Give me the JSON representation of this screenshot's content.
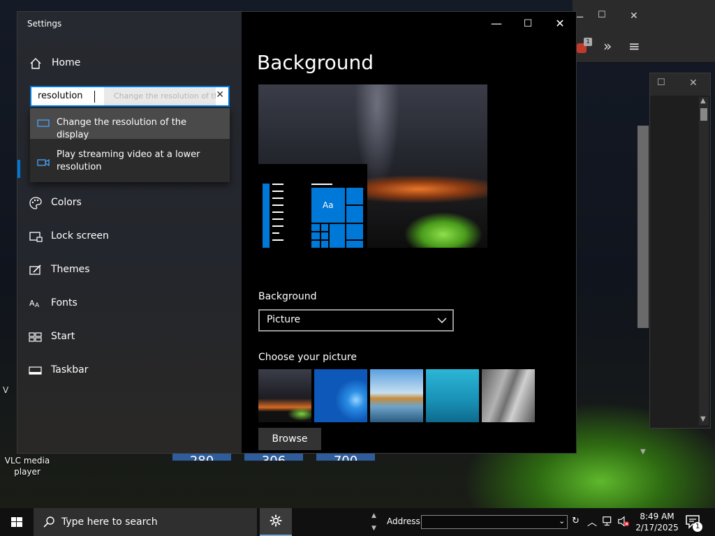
{
  "desktop": {
    "vlc_label": "VLC media player",
    "partial_char": "V",
    "background_numbers": [
      "280",
      "306",
      "700"
    ]
  },
  "bg_browser": {
    "minimize": "—",
    "maximize": "☐",
    "close": "✕",
    "badge_count": "1",
    "overflow": "»",
    "menu": "≡"
  },
  "settings": {
    "app_title": "Settings",
    "home_label": "Home",
    "search": {
      "value": "resolution",
      "suggestion_ghost": "Change the resolution of the display",
      "clear": "✕"
    },
    "suggestions": [
      {
        "label": "Change the resolution of the display",
        "icon": "monitor-icon"
      },
      {
        "label": "Play streaming video at a lower resolution",
        "icon": "video-icon"
      }
    ],
    "nav": [
      {
        "label": "Colors",
        "icon": "palette-icon"
      },
      {
        "label": "Lock screen",
        "icon": "lock-screen-icon"
      },
      {
        "label": "Themes",
        "icon": "themes-icon"
      },
      {
        "label": "Fonts",
        "icon": "fonts-icon"
      },
      {
        "label": "Start",
        "icon": "start-icon"
      },
      {
        "label": "Taskbar",
        "icon": "taskbar-icon"
      }
    ],
    "window_controls": {
      "minimize": "—",
      "maximize": "☐",
      "close": "✕"
    },
    "page_title": "Background",
    "preview_tile_label": "Aa",
    "background_label": "Background",
    "background_value": "Picture",
    "choose_label": "Choose your picture",
    "browse_label": "Browse"
  },
  "taskbar": {
    "search_placeholder": "Type here to search",
    "address_label": "Address",
    "time": "8:49 AM",
    "date": "2/17/2025",
    "notification_count": "1"
  },
  "colors": {
    "accent": "#0078d7",
    "window_bg": "#000000",
    "sidebar_bg": "#26292f",
    "taskbar_bg": "#101010"
  }
}
